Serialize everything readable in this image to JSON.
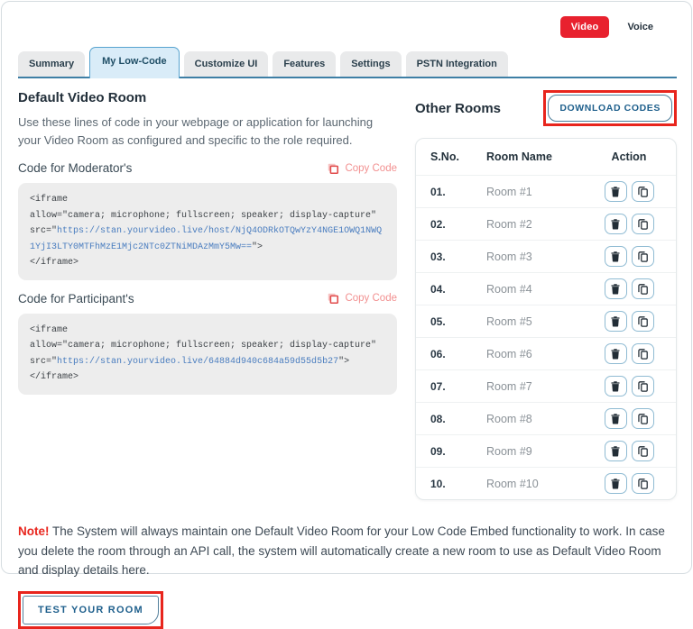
{
  "header": {
    "video_label": "Video",
    "voice_label": "Voice"
  },
  "tabs": [
    {
      "label": "Summary"
    },
    {
      "label": "My Low-Code"
    },
    {
      "label": "Customize UI"
    },
    {
      "label": "Features"
    },
    {
      "label": "Settings"
    },
    {
      "label": "PSTN Integration"
    }
  ],
  "default_room": {
    "title": "Default Video Room",
    "description": "Use these lines of code in your webpage or application for launching your Video Room as configured and specific to the role required.",
    "moderator": {
      "label": "Code for Moderator's",
      "copy_label": "Copy Code",
      "code_line1": "<iframe",
      "code_line2": "allow=\"camera; microphone; fullscreen; speaker; display-capture\"",
      "src_prefix": "src=\"",
      "src_url": "https://stan.yourvideo.live/host/NjQ4ODRkOTQwYzY4NGE1OWQ1NWQ1YjI3LTY0MTFhMzE1Mjc2NTc0ZTNiMDAzMmY5Mw==",
      "src_suffix": "\">",
      "code_line4": "</iframe>"
    },
    "participant": {
      "label": "Code for Participant's",
      "copy_label": "Copy Code",
      "code_line1": "<iframe",
      "code_line2": "allow=\"camera; microphone; fullscreen; speaker; display-capture\"",
      "src_prefix": "src=\"",
      "src_url": "https://stan.yourvideo.live/64884d940c684a59d55d5b27",
      "src_suffix": "\">",
      "code_line4": "</iframe>"
    }
  },
  "other_rooms": {
    "title": "Other Rooms",
    "download_button": "DOWNLOAD CODES",
    "columns": {
      "sno": "S.No.",
      "name": "Room Name",
      "action": "Action"
    },
    "rows": [
      {
        "sno": "01.",
        "name": "Room #1"
      },
      {
        "sno": "02.",
        "name": "Room #2"
      },
      {
        "sno": "03.",
        "name": "Room #3"
      },
      {
        "sno": "04.",
        "name": "Room #4"
      },
      {
        "sno": "05.",
        "name": "Room #5"
      },
      {
        "sno": "06.",
        "name": "Room #6"
      },
      {
        "sno": "07.",
        "name": "Room #7"
      },
      {
        "sno": "08.",
        "name": "Room #8"
      },
      {
        "sno": "09.",
        "name": "Room #9"
      },
      {
        "sno": "10.",
        "name": "Room #10"
      }
    ]
  },
  "note": {
    "prefix": "Note!",
    "text": " The System will always maintain one Default Video Room for your Low Code Embed functionality to work. In case you delete the room through an API call, the system will automatically create a new room to use as Default Video Room and display details here."
  },
  "footer": {
    "test_button": "TEST YOUR ROOM"
  },
  "colors": {
    "accent_red": "#E8212E",
    "annotation_red": "#E8251D",
    "active_tab_bg": "#D9ECF8",
    "tab_border": "#57A3CF",
    "code_url_blue": "#4A7DBF",
    "copy_link_pink": "#F29090",
    "button_navy": "#1E5F8C"
  }
}
